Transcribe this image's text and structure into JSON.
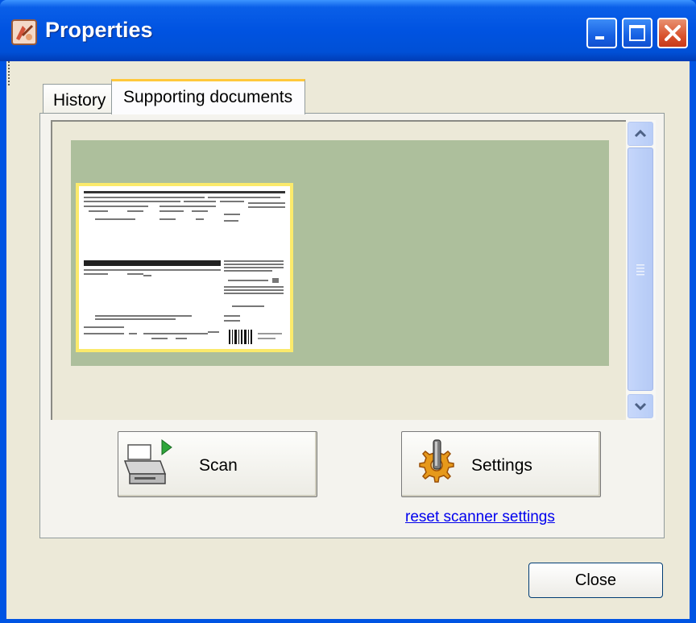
{
  "window": {
    "title": "Properties",
    "buttons": [
      "minimize-icon",
      "maximize-icon",
      "close-icon"
    ]
  },
  "tabs": [
    {
      "label": "History",
      "active": false
    },
    {
      "label": "Supporting documents",
      "active": true
    }
  ],
  "actions": {
    "scan_label": "Scan",
    "settings_label": "Settings",
    "reset_link": "reset scanner settings",
    "close_label": "Close"
  },
  "colors": {
    "titlebar": "#0054e3",
    "preview_background": "#adbf9c",
    "thumbnail_border": "#fbea6b",
    "link": "#0000ee"
  }
}
